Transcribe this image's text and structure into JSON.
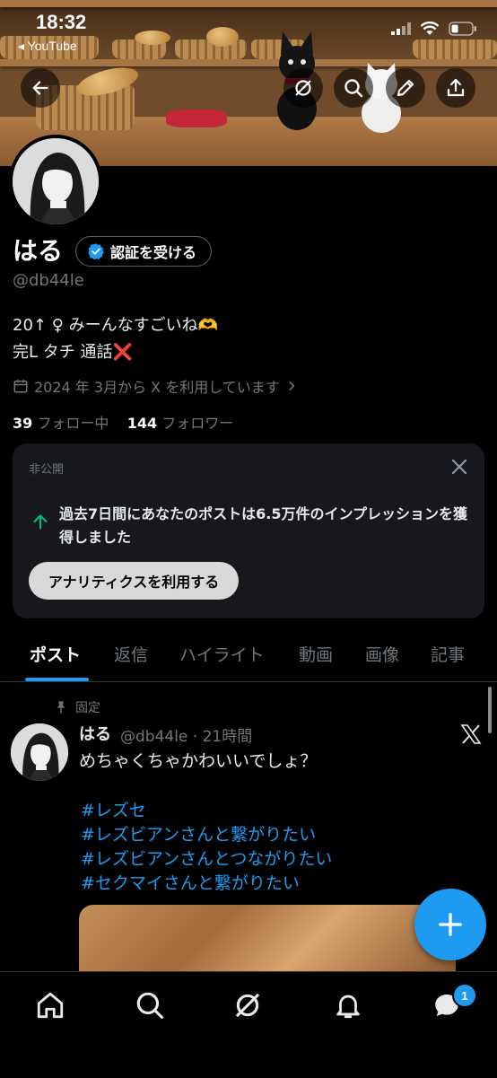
{
  "status_bar": {
    "time": "18:32",
    "back_app": "◂ YouTube"
  },
  "profile": {
    "display_name": "はる",
    "verify_button": "認証を受ける",
    "handle": "@db44le",
    "bio_line1": "20↑ ♀ みーんなすごいね🫶",
    "bio_line2": "完L タチ 通話❌",
    "joined": "2024 年 3月から X を利用しています",
    "following_count": "39",
    "following_label": "フォロー中",
    "followers_count": "144",
    "followers_label": "フォロワー"
  },
  "analytics_card": {
    "private_label": "非公開",
    "message": "過去7日間にあなたのポストは6.5万件のインプレッションを獲得しました",
    "button": "アナリティクスを利用する"
  },
  "tabs": [
    "ポスト",
    "返信",
    "ハイライト",
    "動画",
    "画像",
    "記事"
  ],
  "pinned_post": {
    "pinned_label": "固定",
    "author_name": "はる",
    "meta": "@db44le · 21時間",
    "text": "めちゃくちゃかわいいでしょ？",
    "hashtags": [
      "#レズセ",
      "#レズビアンさんと繋がりたい",
      "#レズビアンさんとつながりたい",
      "#セクマイさんと繋がりたい"
    ]
  },
  "bottom_nav": {
    "notification_badge": "1",
    "items": [
      "home-icon",
      "search-icon",
      "grok-icon",
      "bell-icon",
      "messages-icon"
    ]
  },
  "colors": {
    "accent": "#1d9bf0",
    "background": "#000000",
    "muted_text": "#71767b",
    "card": "#16181c",
    "growth_arrow": "#00ba7c"
  }
}
